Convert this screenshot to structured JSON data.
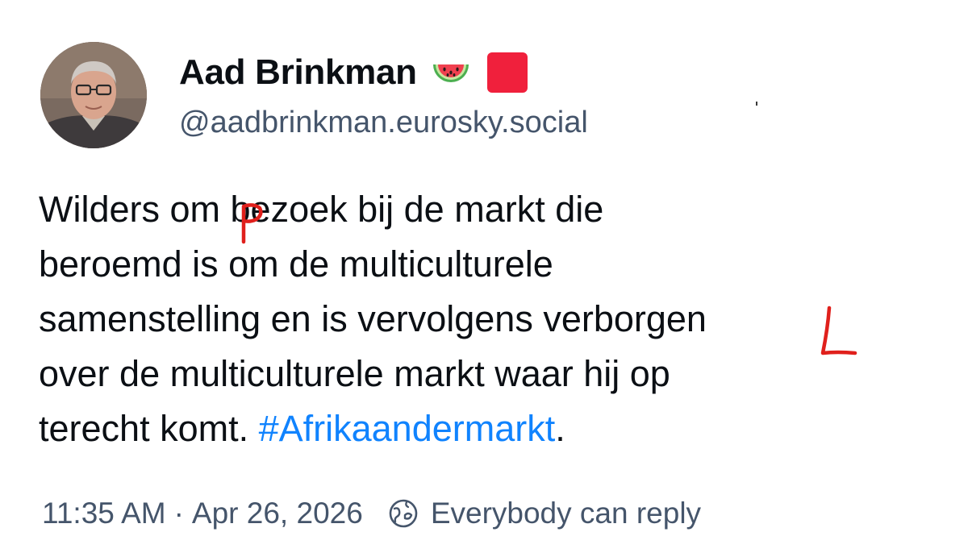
{
  "profile": {
    "display_name": "Aad Brinkman",
    "badges": [
      "watermelon-emoji",
      "red-square-emoji"
    ],
    "handle": "@aadbrinkman.eurosky.social"
  },
  "post": {
    "lines": [
      "Wilders om bezoek bij de markt die",
      "beroemd is om de multiculturele",
      "samenstelling en is vervolgens verborgen",
      "over de multiculturele markt waar hij op",
      "terecht komt. "
    ],
    "hashtag": "#Afrikaandermarkt",
    "trailing_punctuation": ".",
    "handwritten_corrections": [
      {
        "mark": "p",
        "over": "om",
        "color": "#e0201c"
      },
      {
        "mark": "L",
        "over": "verborgen",
        "color": "#e0201c"
      }
    ]
  },
  "meta": {
    "time": "11:35 AM",
    "separator": "·",
    "date": "Apr 26, 2026",
    "reply_setting": "Everybody can reply",
    "reply_icon": "globe-reply-icon"
  },
  "colors": {
    "text": "#0b0f14",
    "secondary": "#45556b",
    "link": "#1083fe",
    "annotation": "#e0201c"
  }
}
